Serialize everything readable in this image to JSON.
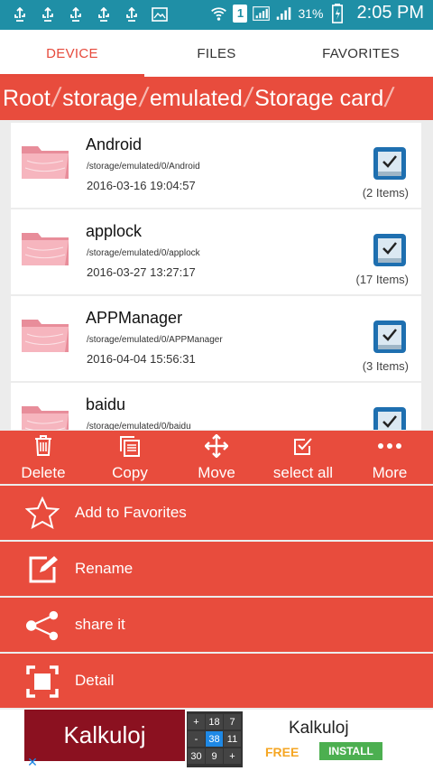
{
  "status": {
    "battery_pct": "31%",
    "time": "2:05 PM",
    "sim_label": "1"
  },
  "tabs": [
    {
      "label": "DEVICE",
      "active": true
    },
    {
      "label": "FILES",
      "active": false
    },
    {
      "label": "FAVORITES",
      "active": false
    }
  ],
  "breadcrumb": [
    "Root",
    "storage",
    "emulated",
    "Storage card"
  ],
  "breadcrumb_sep": "/",
  "items": [
    {
      "name": "Android",
      "path": "/storage/emulated/0/Android",
      "date": "2016-03-16 19:04:57",
      "count": "(2 Items)"
    },
    {
      "name": "applock",
      "path": "/storage/emulated/0/applock",
      "date": "2016-03-27 13:27:17",
      "count": "(17 Items)"
    },
    {
      "name": "APPManager",
      "path": "/storage/emulated/0/APPManager",
      "date": "2016-04-04 15:56:31",
      "count": "(3 Items)"
    },
    {
      "name": "baidu",
      "path": "/storage/emulated/0/baidu",
      "date": "",
      "count": ""
    }
  ],
  "toolbar": {
    "delete": "Delete",
    "copy": "Copy",
    "move": "Move",
    "select_all": "select all",
    "more": "More"
  },
  "menu": {
    "favorites": "Add to Favorites",
    "rename": "Rename",
    "share": "share it",
    "detail": "Detail"
  },
  "ad": {
    "left_title": "Kalkuloj",
    "title": "Kalkuloj",
    "free": "FREE",
    "install": "INSTALL",
    "grid": [
      "+",
      "18",
      "7",
      "-",
      "38",
      "11",
      "30",
      "9",
      "+"
    ],
    "close": "✕"
  },
  "colors": {
    "accent": "#e84c3d",
    "statusbar": "#1f8fa6",
    "folder": "#f2a6b0"
  }
}
